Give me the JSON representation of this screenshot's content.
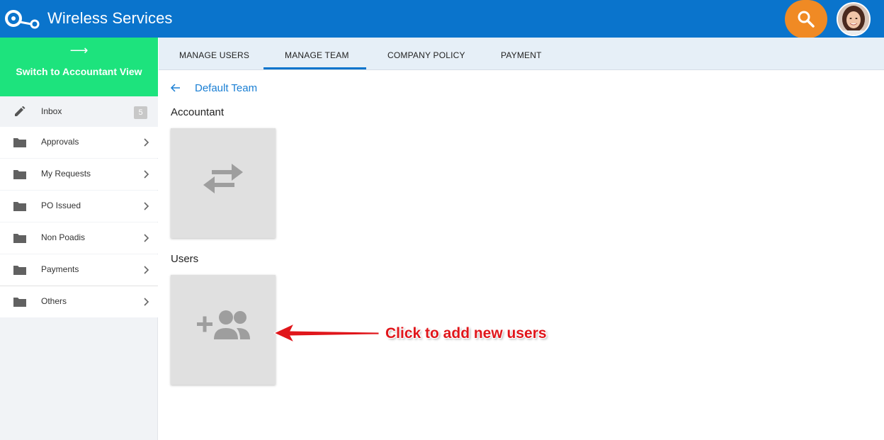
{
  "app": {
    "title": "Wireless Services",
    "logo_icon": "logo-icon",
    "brand_color": "#0a74cc"
  },
  "header": {
    "search_icon": "search-icon",
    "search_color": "#f08a24",
    "avatar_icon": "avatar"
  },
  "sidebar": {
    "switch_arrow": "⟶",
    "switch_label": "Switch to Accountant View",
    "switch_color": "#1de37d",
    "items": [
      {
        "label": "Inbox",
        "icon": "pencil-icon",
        "badge": "5"
      },
      {
        "label": "Approvals",
        "icon": "folder-icon"
      },
      {
        "label": "My Requests",
        "icon": "folder-icon"
      },
      {
        "label": "PO Issued",
        "icon": "folder-icon"
      },
      {
        "label": "Non Poadis",
        "icon": "folder-icon"
      },
      {
        "label": "Payments",
        "icon": "folder-icon"
      },
      {
        "label": "Others",
        "icon": "folder-icon"
      }
    ]
  },
  "tabs": [
    {
      "label": "MANAGE USERS",
      "active": false
    },
    {
      "label": "MANAGE TEAM",
      "active": true
    },
    {
      "label": "COMPANY POLICY",
      "active": false
    },
    {
      "label": "PAYMENT",
      "active": false
    }
  ],
  "main": {
    "breadcrumb": "Default Team",
    "accountant_title": "Accountant",
    "users_title": "Users",
    "accountant_card_icon": "swap-icon",
    "users_card_icon": "add-group-icon"
  },
  "annotation": {
    "text": "Click to add new users",
    "color": "#e0161b"
  }
}
